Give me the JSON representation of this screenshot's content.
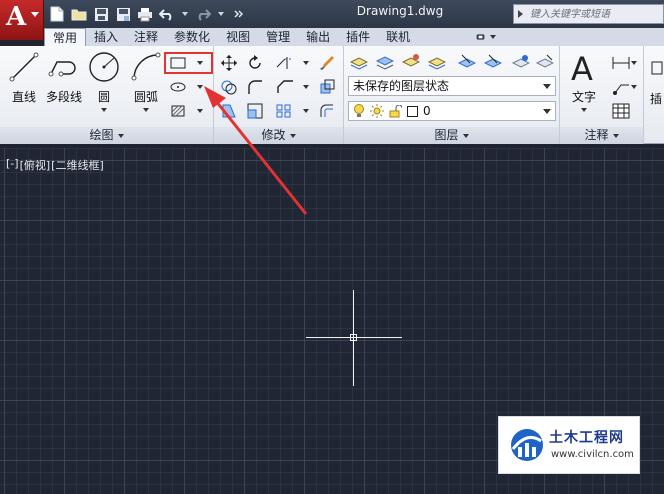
{
  "title_bar": {
    "document_title": "Drawing1.dwg",
    "search_placeholder": "键入关键字或短语",
    "qat_icons": [
      "new-file-icon",
      "open-folder-icon",
      "save-icon",
      "save-as-icon",
      "print-icon",
      "undo-icon",
      "redo-icon",
      "more-chevron-icon"
    ]
  },
  "ribbon_tabs": [
    {
      "label": "常用",
      "active": true
    },
    {
      "label": "插入",
      "active": false
    },
    {
      "label": "注释",
      "active": false
    },
    {
      "label": "参数化",
      "active": false
    },
    {
      "label": "视图",
      "active": false
    },
    {
      "label": "管理",
      "active": false
    },
    {
      "label": "输出",
      "active": false
    },
    {
      "label": "插件",
      "active": false
    },
    {
      "label": "联机",
      "active": false
    }
  ],
  "panels": {
    "draw": {
      "title": "绘图",
      "buttons": {
        "line": "直线",
        "polyline": "多段线",
        "circle": "圆",
        "arc": "圆弧"
      }
    },
    "modify": {
      "title": "修改"
    },
    "layers": {
      "title": "图层",
      "layer_state_value": "未保存的图层状态",
      "current_layer_value": "0"
    },
    "annotation": {
      "title": "注释",
      "text_button": "文字",
      "partial_label": "插"
    }
  },
  "drawing_area": {
    "viewport_labels": [
      "[-]",
      "[俯视]",
      "[二维线框]"
    ]
  },
  "watermark": {
    "name": "土木工程网",
    "url": "www.civilcn.com"
  },
  "colors": {
    "highlight": "#e23232",
    "app_button": "#c62a2a",
    "canvas": "#202633"
  }
}
